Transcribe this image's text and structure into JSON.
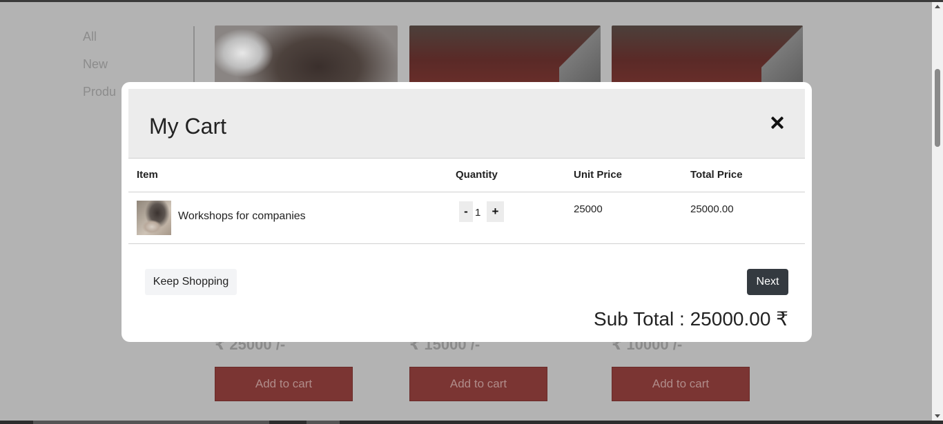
{
  "background_page": {
    "categories": [
      "All",
      "New",
      "Produ"
    ],
    "products": [
      {
        "price": "₹ 25000 /-",
        "button_label": "Add to cart"
      },
      {
        "price": "₹ 15000 /-",
        "button_label": "Add to cart"
      },
      {
        "price": "₹ 10000 /-",
        "button_label": "Add to cart"
      }
    ]
  },
  "modal": {
    "title": "My Cart",
    "close_icon": "close-icon",
    "columns": {
      "item": "Item",
      "quantity": "Quantity",
      "unit_price": "Unit Price",
      "total_price": "Total Price"
    },
    "rows": [
      {
        "item_name": "Workshops for companies",
        "quantity": "1",
        "decrement_label": "-",
        "increment_label": "+",
        "unit_price": "25000",
        "total_price": "25000.00"
      }
    ],
    "keep_shopping_label": "Keep Shopping",
    "next_label": "Next",
    "subtotal_text": "Sub Total : 25000.00 ₹"
  },
  "colors": {
    "overlay": "#b3b3b3",
    "modal_header_bg": "#ececec",
    "next_button_bg": "#343a40",
    "add_to_cart_bg": "#7b3533"
  }
}
